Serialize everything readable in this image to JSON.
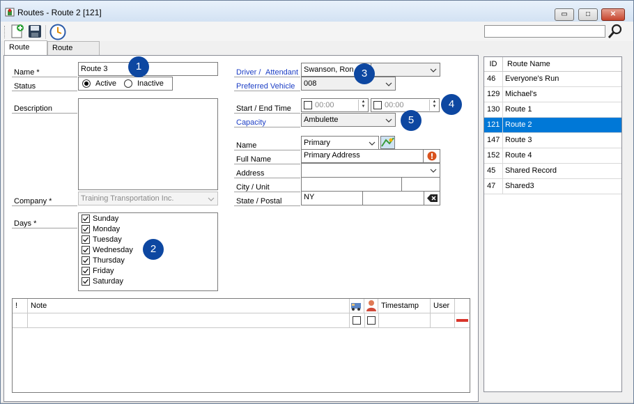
{
  "window": {
    "title": "Routes - Route 2 [121]",
    "controls": {
      "minimize": "▭",
      "maximize": "□",
      "close": "✕"
    }
  },
  "toolbar": {
    "icons": [
      "new-document-icon",
      "save-icon",
      "schedule-clock-icon"
    ],
    "search_placeholder": "",
    "search_icon": "magnifier-icon"
  },
  "tabs": [
    {
      "label": "Route Info",
      "active": true
    },
    {
      "label": "Route Builder",
      "active": false
    }
  ],
  "form": {
    "name_label": "Name *",
    "name_value": "Route 3",
    "status_label": "Status",
    "status_options": [
      "Active",
      "Inactive"
    ],
    "status_selected": "Active",
    "description_label": "Description",
    "description_value": "",
    "company_label": "Company *",
    "company_value": "Training Transportation Inc.",
    "days_label": "Days *",
    "days": [
      {
        "label": "Sunday",
        "checked": true
      },
      {
        "label": "Monday",
        "checked": true
      },
      {
        "label": "Tuesday",
        "checked": true
      },
      {
        "label": "Wednesday",
        "checked": true
      },
      {
        "label": "Thursday",
        "checked": true
      },
      {
        "label": "Friday",
        "checked": true
      },
      {
        "label": "Saturday",
        "checked": true
      }
    ],
    "driver_label": "Driver /",
    "attendant_label": "Attendant",
    "driver_value": "Swanson, Ron",
    "attendant_value": "",
    "vehicle_label": "Preferred Vehicle",
    "vehicle_value": "008",
    "time_label": "Start / End Time",
    "start_time": "00:00",
    "end_time": "00:00",
    "capacity_label": "Capacity",
    "capacity_value": "Ambulette",
    "address_name_label": "Name",
    "address_name_value": "Primary",
    "full_name_label": "Full Name",
    "full_name_value": "Primary Address",
    "address_label": "Address",
    "address_value": "",
    "city_label": "City / Unit",
    "city_value": "",
    "unit_value": "",
    "state_label": "State / Postal",
    "state_value": "NY",
    "postal_value": ""
  },
  "badges": [
    "1",
    "2",
    "3",
    "4",
    "5"
  ],
  "notes": {
    "columns": [
      "!",
      "Note",
      "",
      "",
      "Timestamp",
      "User"
    ],
    "column_icons": [
      "vehicle-icon",
      "person-icon"
    ],
    "rows": [
      {
        "flag": "",
        "note": "",
        "vehicle": false,
        "person": false,
        "timestamp": "",
        "user": ""
      }
    ]
  },
  "route_list": {
    "columns": [
      "ID",
      "Route Name"
    ],
    "rows": [
      {
        "id": "46",
        "name": "Everyone's Run",
        "selected": false
      },
      {
        "id": "129",
        "name": "Michael's",
        "selected": false
      },
      {
        "id": "130",
        "name": "Route 1",
        "selected": false
      },
      {
        "id": "121",
        "name": "Route 2",
        "selected": true
      },
      {
        "id": "147",
        "name": "Route 3",
        "selected": false
      },
      {
        "id": "152",
        "name": "Route 4",
        "selected": false
      },
      {
        "id": "45",
        "name": "Shared Record",
        "selected": false
      },
      {
        "id": "47",
        "name": "Shared3",
        "selected": false
      }
    ]
  },
  "colors": {
    "accent": "#0078d7",
    "badge": "#0d47a1",
    "link_label": "#1c3ec5"
  }
}
